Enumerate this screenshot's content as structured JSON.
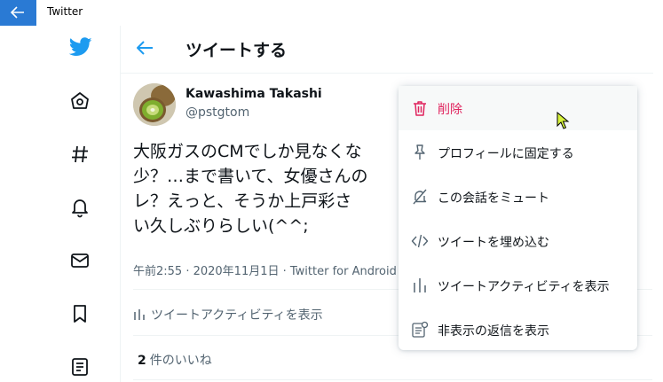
{
  "window": {
    "title": "Twitter"
  },
  "nav": {
    "items": [
      "twitter-logo",
      "home-icon",
      "hashtag-icon",
      "bell-icon",
      "mail-icon",
      "bookmark-icon",
      "list-icon"
    ]
  },
  "header": {
    "title": "ツイートする"
  },
  "tweet": {
    "display_name": "Kawashima Takashi",
    "handle": "@pstgtom",
    "text": "大阪ガスのCMでしか見なくな\n少？…まで書いて、女優さんの\nレ？えっと、そうか上戸彩さ\nい久しぶりらしい(^^;",
    "meta": "午前2:55 · 2020年11月1日 · Twitter for Android",
    "activity_label": "ツイートアクティビティを表示",
    "likes_count": "2",
    "likes_label": "件のいいね"
  },
  "menu": {
    "items": [
      {
        "label": "削除",
        "icon": "trash-icon",
        "danger": true
      },
      {
        "label": "プロフィールに固定する",
        "icon": "pin-icon"
      },
      {
        "label": "この会話をミュート",
        "icon": "mute-icon"
      },
      {
        "label": "ツイートを埋め込む",
        "icon": "code-icon"
      },
      {
        "label": "ツイートアクティビティを表示",
        "icon": "chart-icon"
      },
      {
        "label": "非表示の返信を表示",
        "icon": "hidden-replies-icon"
      }
    ]
  },
  "colors": {
    "accent": "#1d9bf0",
    "danger": "#e0245e",
    "titlebar_back": "#2a7ad4",
    "muted_text": "#536471"
  }
}
